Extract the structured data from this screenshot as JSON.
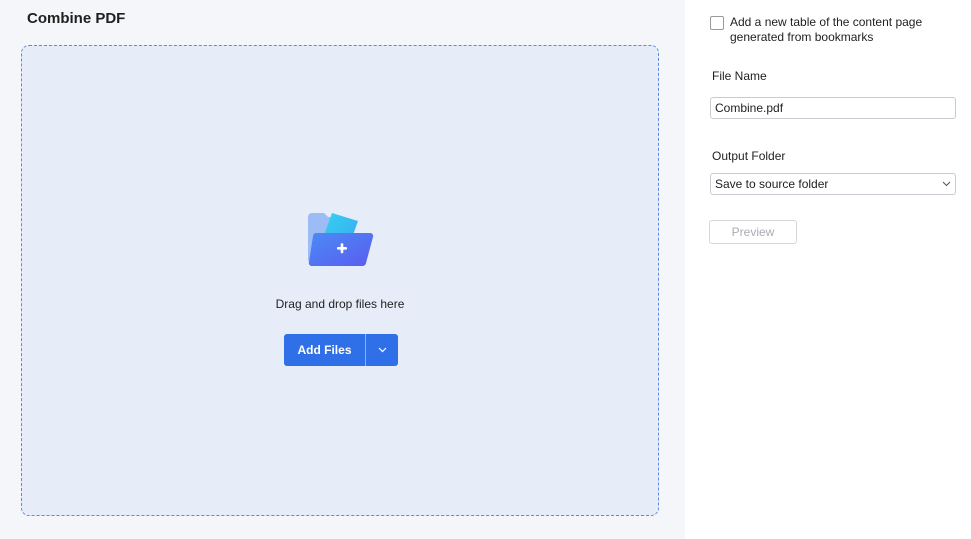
{
  "page": {
    "title": "Combine PDF"
  },
  "drop_zone": {
    "instruction": "Drag and drop files here",
    "add_files_label": "Add Files",
    "icon": "folder-add-icon"
  },
  "options": {
    "toc_checkbox_label": "Add a new table of the content page generated from bookmarks",
    "toc_checked": false
  },
  "file_name": {
    "label": "File Name",
    "value": "Combine.pdf"
  },
  "output_folder": {
    "label": "Output Folder",
    "selected": "Save to source folder"
  },
  "actions": {
    "preview_label": "Preview",
    "preview_enabled": false
  },
  "colors": {
    "accent": "#2f6fe8",
    "drop_zone_bg": "#e6edf8",
    "drop_zone_border": "#5b8ae0",
    "left_bg": "#f4f6f9",
    "disabled_text": "#a8acb2"
  }
}
